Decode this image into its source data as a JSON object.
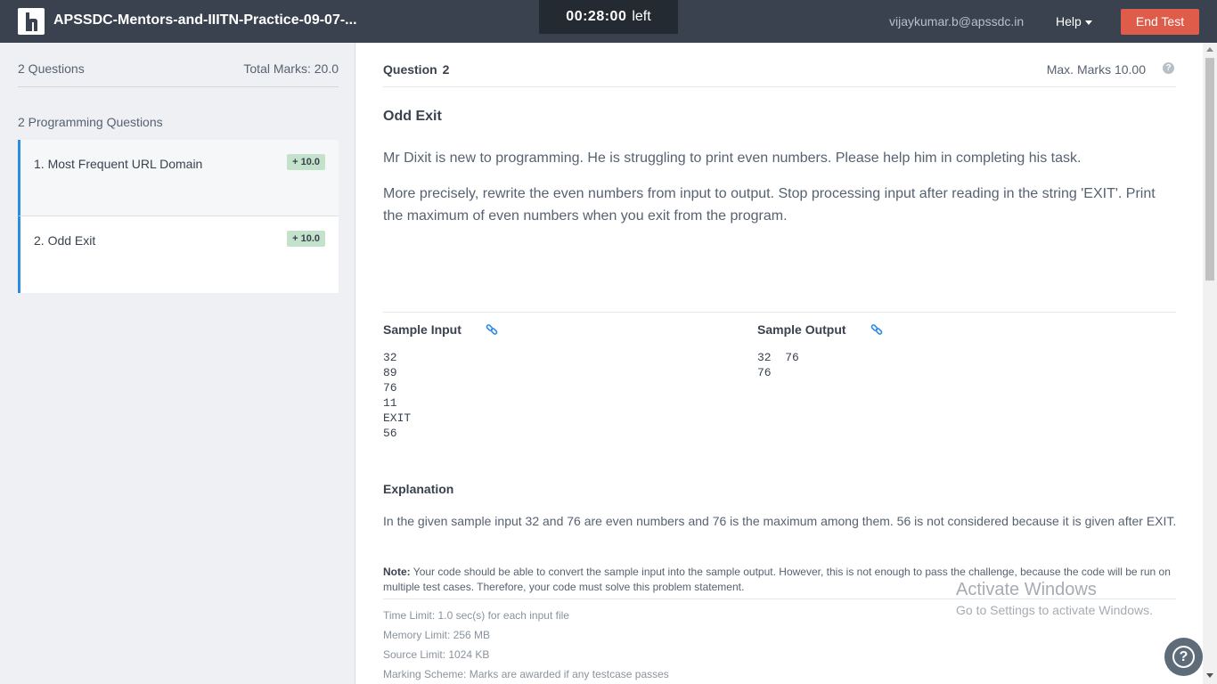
{
  "header": {
    "contest_title": "APSSDC-Mentors-and-IIITN-Practice-09-07-...",
    "timer_value": "00:28:00",
    "timer_suffix": "left",
    "user_email": "vijaykumar.b@apssdc.in",
    "help_label": "Help",
    "end_test_label": "End Test",
    "logo_letter": "h"
  },
  "sidebar": {
    "question_count": "2 Questions",
    "total_marks": "Total Marks: 20.0",
    "section_label": "2 Programming Questions",
    "items": [
      {
        "label": "1. Most Frequent URL Domain",
        "badge": "+ 10.0"
      },
      {
        "label": "2. Odd Exit",
        "badge": "+ 10.0"
      }
    ]
  },
  "question": {
    "label": "Question",
    "number": "2",
    "max_marks": "Max. Marks 10.00",
    "help_glyph": "?",
    "title": "Odd Exit",
    "paragraphs": [
      "Mr Dixit is new to programming. He is struggling to print even numbers. Please help him in completing his task.",
      "More precisely, rewrite the even numbers from input to output.  Stop processing input after reading in the string 'EXIT'. Print the maximum of even numbers when you exit from the program."
    ],
    "sample_input_label": "Sample Input",
    "sample_output_label": "Sample Output",
    "sample_input": "32\n89\n76\n11\nEXIT\n56",
    "sample_output": "32  76\n76",
    "explanation_label": "Explanation",
    "explanation": "In the given sample input 32 and 76 are even numbers and 76 is the maximum among them. 56 is not considered because it is given after EXIT.",
    "note_label": "Note:",
    "note": " Your code should be able to convert the sample input into the sample output. However, this is not enough to pass the challenge, because the code will be run on multiple test cases. Therefore, your code must solve this problem statement.",
    "limits": [
      "Time Limit: 1.0 sec(s) for each input file",
      "Memory Limit: 256 MB",
      "Source Limit: 1024 KB",
      "Marking Scheme: Marks are awarded if any testcase passes"
    ]
  },
  "watermark": {
    "title": "Activate Windows",
    "subtitle": "Go to Settings to activate Windows."
  },
  "float_help_glyph": "?",
  "icons": {
    "logo": "hackerearth-logo-icon",
    "caret": "caret-down-icon",
    "question_help": "question-circle-icon",
    "copy_link": "link-icon",
    "float_help": "help-circle-icon"
  },
  "colors": {
    "topbar": "#39424e",
    "end_button": "#e05c4a",
    "accent": "#2b8ce3",
    "badge": "#c4e1cb",
    "sidebar_bg": "#eef0f3"
  }
}
